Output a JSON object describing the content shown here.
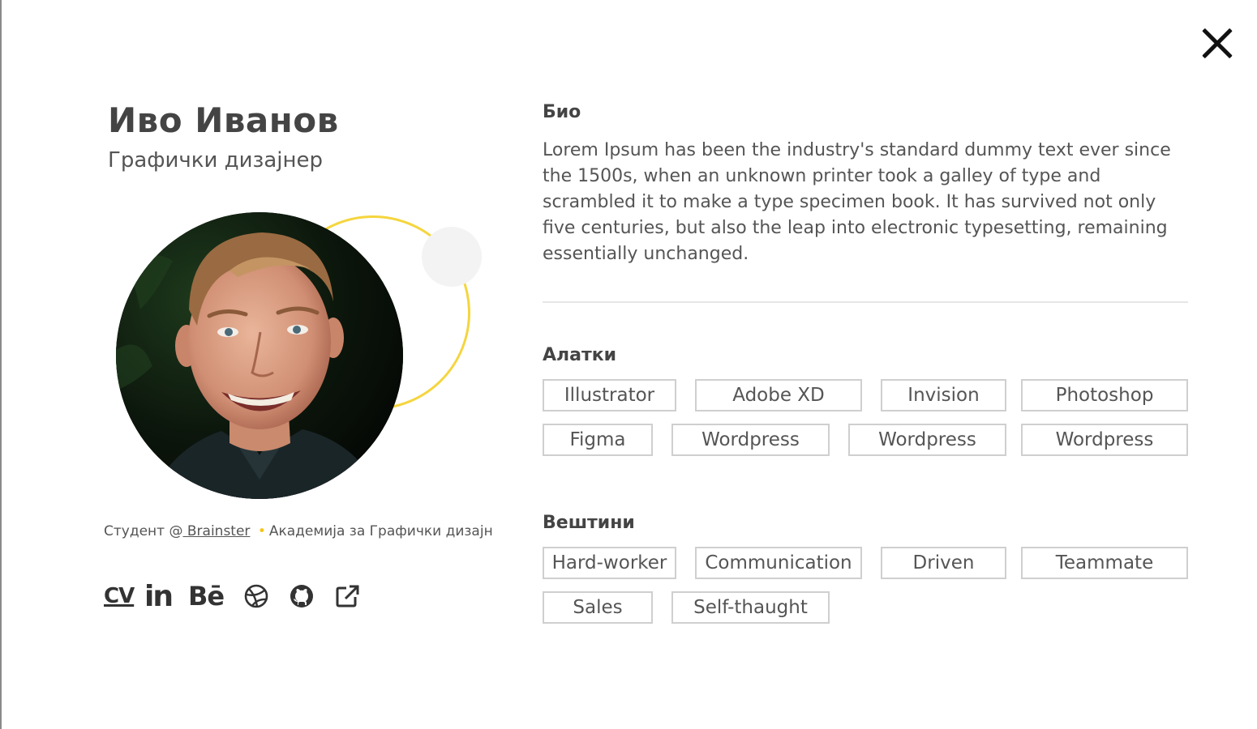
{
  "profile": {
    "name": "Иво Иванов",
    "role": "Графички дизајнер",
    "student_prefix": "Студент @",
    "student_org": " Brainster",
    "student_separator": "•",
    "student_academy": "Академија за Графички дизајн"
  },
  "links": {
    "cv": "CV",
    "linkedin": "in",
    "behance": "Bē",
    "icons": [
      "dribbble-icon",
      "github-icon",
      "external-link-icon"
    ]
  },
  "bio": {
    "title": "Био",
    "text": "Lorem Ipsum has been the industry's standard dummy text ever since the 1500s, when an unknown printer took a galley of type and scrambled it to make a type specimen book. It has survived not only five centuries, but also the leap into electronic typesetting, remaining essentially unchanged."
  },
  "tools": {
    "title": "Алатки",
    "items": [
      "Illustrator",
      "Adobe XD",
      "Invision",
      "Photoshop",
      "Figma",
      "Wordpress",
      "Wordpress",
      "Wordpress"
    ]
  },
  "skills": {
    "title": "Вештини",
    "items": [
      "Hard-worker",
      "Communication",
      "Driven",
      "Teammate",
      "Sales",
      "Self-thaught"
    ]
  },
  "colors": {
    "accent": "#f5d53e",
    "text": "#444444",
    "border": "#cfcfcf"
  }
}
